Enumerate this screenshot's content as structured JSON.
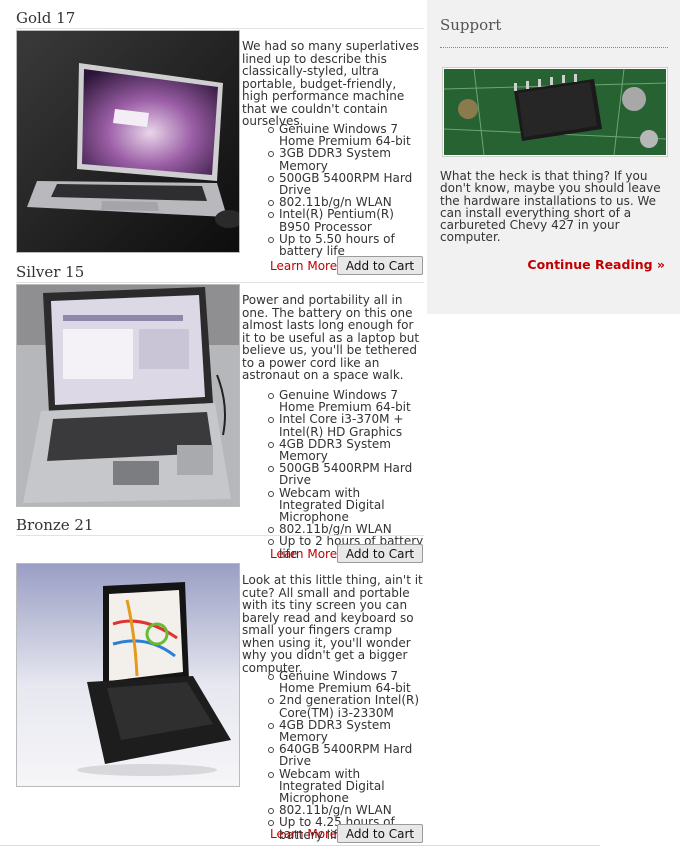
{
  "products": [
    {
      "title": "Gold 17",
      "description": "We had so many superlatives lined up to describe this classically-styled, ultra portable, budget-friendly, high performance machine that we couldn't contain ourselves.",
      "specs": [
        "Genuine Windows 7 Home Premium 64-bit",
        "3GB DDR3 System Memory",
        "500GB 5400RPM Hard Drive",
        "802.11b/g/n WLAN",
        "Intel(R) Pentium(R) B950 Processor",
        "Up to 5.50 hours of battery life"
      ],
      "learn_more": "Learn More",
      "cart": "Add to Cart"
    },
    {
      "title": "Silver 15",
      "description": "Power and portability all in one. The battery on this one almost lasts long enough for it to be useful as a laptop but believe us, you'll be tethered to a power cord like an astronaut on a space walk.",
      "specs": [
        "Genuine Windows 7 Home Premium 64-bit",
        "Intel Core i3-370M + Intel(R) HD Graphics",
        "4GB DDR3 System Memory",
        "500GB 5400RPM Hard Drive",
        "Webcam with Integrated Digital Microphone",
        "802.11b/g/n WLAN",
        "Up to 2 hours of battery life"
      ],
      "learn_more": "Learn More",
      "cart": "Add to Cart"
    },
    {
      "title": "Bronze 21",
      "description": "Look at this little thing, ain't it cute? All small and portable with its tiny screen you can barely read and keyboard so small your fingers cramp when using it, you'll wonder why you didn't get a bigger computer.",
      "specs": [
        "Genuine Windows 7 Home Premium 64-bit",
        "2nd generation Intel(R) Core(TM) i3-2330M",
        "4GB DDR3 System Memory",
        "640GB 5400RPM Hard Drive",
        "Webcam with Integrated Digital Microphone",
        "802.11b/g/n WLAN",
        "Up to 4.25 hours of battery life"
      ],
      "learn_more": "Learn More",
      "cart": "Add to Cart"
    }
  ],
  "support": {
    "title": "Support",
    "text": "What the heck is that thing? If you don't know, maybe you should leave the hardware installations to us. We can install everything short of a carbureted Chevy 427 in your computer.",
    "continue_label": "Continue Reading »"
  },
  "colors": {
    "link": "#c00000",
    "sidebar_bg": "#f1f1f1"
  }
}
